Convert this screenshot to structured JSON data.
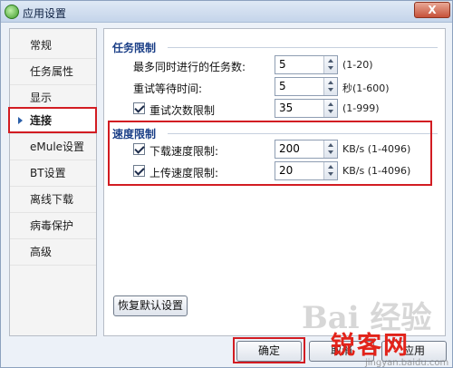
{
  "window": {
    "title": "应用设置",
    "close_glyph": "X"
  },
  "sidebar": {
    "items": [
      {
        "label": "常规"
      },
      {
        "label": "任务属性"
      },
      {
        "label": "显示"
      },
      {
        "label": "连接"
      },
      {
        "label": "eMule设置"
      },
      {
        "label": "BT设置"
      },
      {
        "label": "离线下载"
      },
      {
        "label": "病毒保护"
      },
      {
        "label": "高级"
      }
    ],
    "selected_label": "连接"
  },
  "task_limits": {
    "title": "任务限制",
    "max_tasks": {
      "label": "最多同时进行的任务数:",
      "value": "5",
      "range": "(1-20)"
    },
    "retry_wait": {
      "label": "重试等待时间:",
      "value": "5",
      "unit_range": "秒(1-600)"
    },
    "retry_limit": {
      "label": "重试次数限制",
      "value": "35",
      "range": "(1-999)",
      "checked": true
    }
  },
  "speed_limits": {
    "title": "速度限制",
    "download": {
      "label": "下载速度限制:",
      "value": "200",
      "unit_range": "KB/s (1-4096)",
      "checked": true
    },
    "upload": {
      "label": "上传速度限制:",
      "value": "20",
      "unit_range": "KB/s (1-4096)",
      "checked": true
    }
  },
  "buttons": {
    "restore_defaults": "恢复默认设置",
    "ok": "确定",
    "cancel": "取消",
    "apply": "应用"
  },
  "watermark": {
    "brand": "锐客网",
    "logo": "Bai 经验",
    "url": "jingyan.baidu.com"
  },
  "colors": {
    "highlight": "#d21c22",
    "section_title": "#1b3f87"
  }
}
